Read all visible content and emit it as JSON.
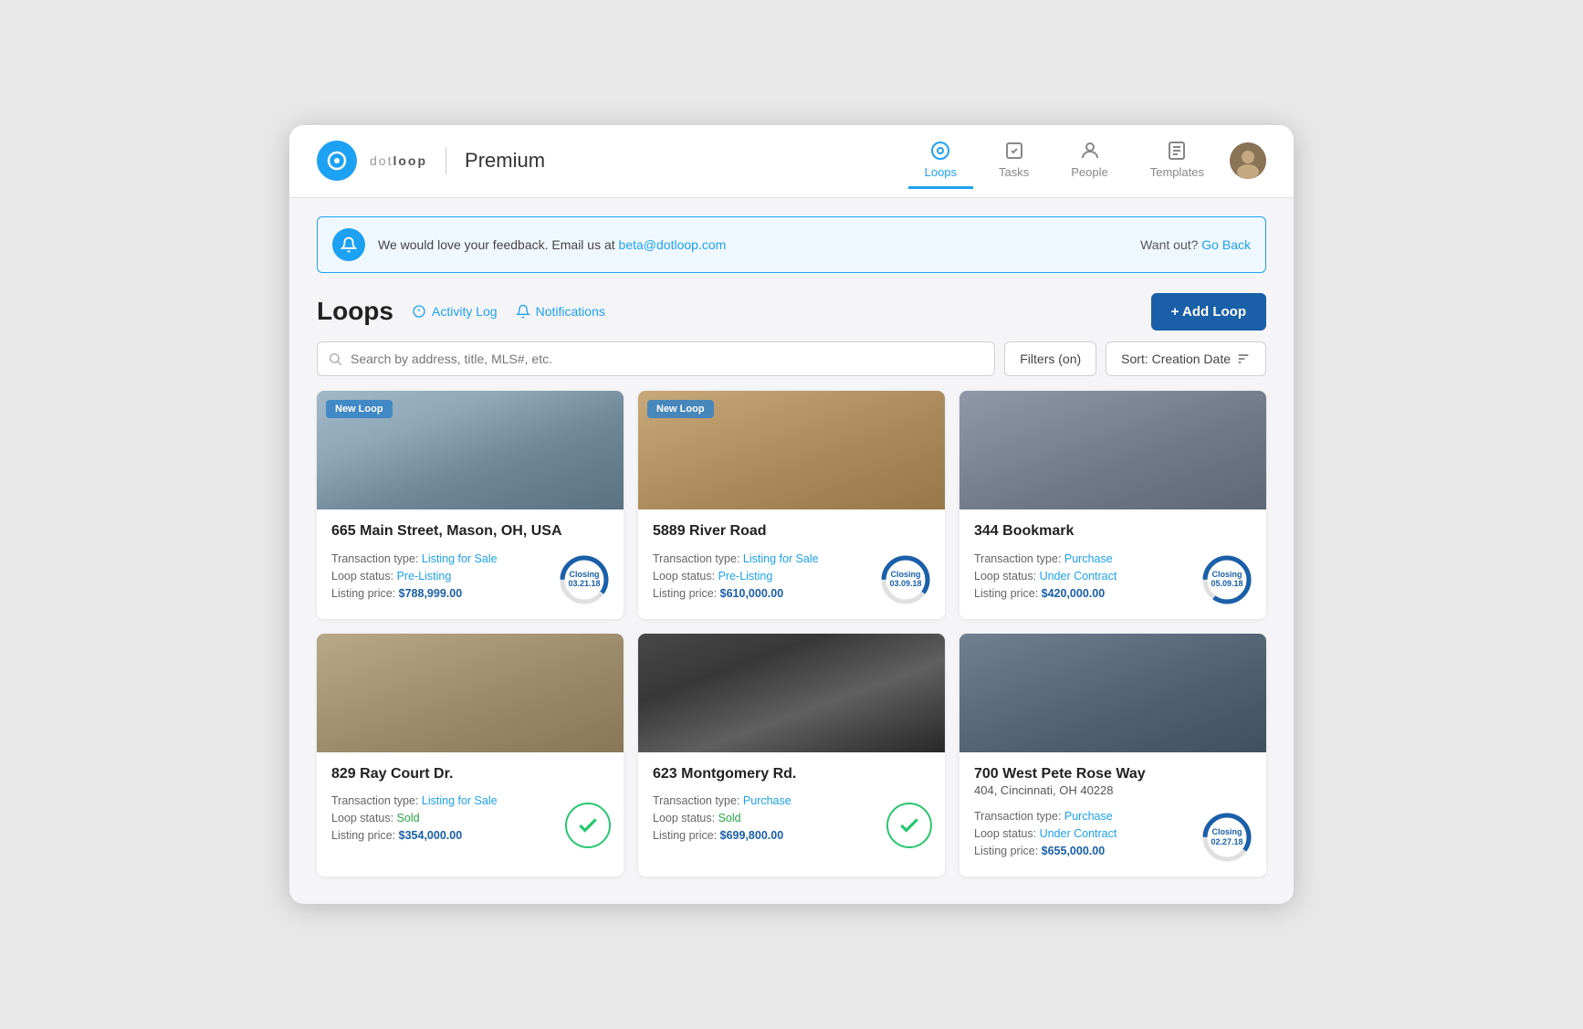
{
  "header": {
    "logo_dot_text": "dot",
    "logo_loop_text": "loop",
    "brand": "Premium",
    "nav": [
      {
        "id": "loops",
        "label": "Loops",
        "active": true
      },
      {
        "id": "tasks",
        "label": "Tasks",
        "active": false
      },
      {
        "id": "people",
        "label": "People",
        "active": false
      },
      {
        "id": "templates",
        "label": "Templates",
        "active": false
      }
    ]
  },
  "banner": {
    "text": "We would love your feedback. Email us at ",
    "email": "beta@dotloop.com",
    "right_text": "Want out?",
    "go_back": "Go Back"
  },
  "page": {
    "title": "Loops",
    "activity_log": "Activity Log",
    "notifications": "Notifications",
    "add_loop": "+ Add Loop"
  },
  "search": {
    "placeholder": "Search by address, title, MLS#, etc.",
    "filter_label": "Filters (on)",
    "sort_label": "Sort: Creation Date"
  },
  "cards": [
    {
      "id": "card1",
      "new_loop": true,
      "address": "665 Main Street, Mason, OH, USA",
      "transaction_type_label": "Transaction type:",
      "transaction_type": "Listing for Sale",
      "loop_status_label": "Loop status:",
      "loop_status": "Pre-Listing",
      "listing_price_label": "Listing price:",
      "listing_price": "$788,999.00",
      "closing_label": "Closing",
      "closing_date": "03.21.18",
      "status_type": "closing",
      "house_class": "house-1"
    },
    {
      "id": "card2",
      "new_loop": true,
      "address": "5889 River Road",
      "transaction_type_label": "Transaction type:",
      "transaction_type": "Listing for Sale",
      "loop_status_label": "Loop status:",
      "loop_status": "Pre-Listing",
      "listing_price_label": "Listing price:",
      "listing_price": "$610,000.00",
      "closing_label": "Closing",
      "closing_date": "03.09.18",
      "status_type": "closing",
      "house_class": "house-2"
    },
    {
      "id": "card3",
      "new_loop": false,
      "address": "344 Bookmark",
      "transaction_type_label": "Transaction type:",
      "transaction_type": "Purchase",
      "loop_status_label": "Loop status:",
      "loop_status": "Under Contract",
      "listing_price_label": "Listing price:",
      "listing_price": "$420,000.00",
      "closing_label": "Closing",
      "closing_date": "05.09.18",
      "status_type": "closing",
      "house_class": "house-3"
    },
    {
      "id": "card4",
      "new_loop": false,
      "address": "829 Ray Court Dr.",
      "transaction_type_label": "Transaction type:",
      "transaction_type": "Listing for Sale",
      "loop_status_label": "Loop status:",
      "loop_status": "Sold",
      "listing_price_label": "Listing price:",
      "listing_price": "$354,000.00",
      "closing_label": "",
      "closing_date": "",
      "status_type": "sold",
      "house_class": "house-4"
    },
    {
      "id": "card5",
      "new_loop": false,
      "address": "623 Montgomery Rd.",
      "transaction_type_label": "Transaction type:",
      "transaction_type": "Purchase",
      "loop_status_label": "Loop status:",
      "loop_status": "Sold",
      "listing_price_label": "Listing price:",
      "listing_price": "$699,800.00",
      "closing_label": "",
      "closing_date": "",
      "status_type": "sold",
      "house_class": "house-5"
    },
    {
      "id": "card6",
      "new_loop": false,
      "address": "700 West Pete Rose Way",
      "address_sub": "404, Cincinnati, OH 40228",
      "transaction_type_label": "Transaction type:",
      "transaction_type": "Purchase",
      "loop_status_label": "Loop status:",
      "loop_status": "Under Contract",
      "listing_price_label": "Listing price:",
      "listing_price": "$655,000.00",
      "closing_label": "Closing",
      "closing_date": "02.27.18",
      "status_type": "closing",
      "house_class": "house-6"
    }
  ],
  "colors": {
    "blue": "#1da1f2",
    "dark_blue": "#1a5fa8",
    "green": "#28c76f"
  }
}
